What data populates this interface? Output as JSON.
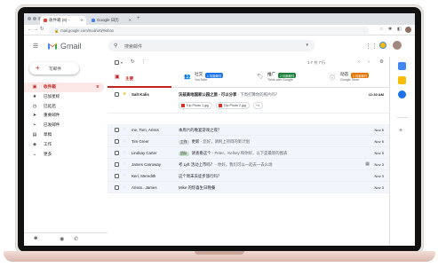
{
  "browser": {
    "tabs": [
      {
        "label": "收件箱 (8) - ",
        "active": true
      },
      {
        "label": "Google 日历",
        "active": false
      }
    ],
    "url": "mail.google.com/mail/u/0/#inbox"
  },
  "header": {
    "app_name": "Gmail",
    "search_placeholder": "搜索邮件"
  },
  "sidebar": {
    "compose_label": "写邮件",
    "items": [
      {
        "label": "收件箱",
        "icon": "inbox-icon",
        "count": "8",
        "active": true
      },
      {
        "label": "已加星标",
        "icon": "star-icon"
      },
      {
        "label": "已延后",
        "icon": "clock-icon"
      },
      {
        "label": "重要邮件",
        "icon": "important-icon"
      },
      {
        "label": "已发邮件",
        "icon": "send-icon"
      },
      {
        "label": "草稿",
        "icon": "draft-icon"
      },
      {
        "label": "工作",
        "icon": "label-icon"
      },
      {
        "label": "更多",
        "icon": "expand-icon"
      }
    ]
  },
  "toolbar": {
    "pagination": "1-7 共 7 行"
  },
  "categories": [
    {
      "name": "主要",
      "icon": "inbox-icon",
      "active": true
    },
    {
      "name": "社交",
      "icon": "people-icon",
      "badge": "1 封新邮件",
      "badge_color": "#1a73e8",
      "sub": "YouTube"
    },
    {
      "name": "推广",
      "icon": "tag-icon",
      "badge": "2 封新邮件",
      "badge_color": "#188038",
      "sub": "Think with Google"
    },
    {
      "name": "动态",
      "icon": "info-icon",
      "badge": "3 封新邮件",
      "badge_color": "#e37400",
      "sub": "Google Store"
    }
  ],
  "emails": [
    {
      "sender": "Salt Kalis",
      "subject": "沃兹美地国家公园之旅 - 可以分享",
      "snippet": "下周打算你的照片吗？",
      "date": "11:30 AM",
      "unread": true,
      "attachments": [
        "Trip Photo 1.jpg",
        "Trip Photo 2.jpg",
        "+1"
      ]
    },
    {
      "sender": "me, Tom, Arisss",
      "subject": "本周六的晚宴游戏之夜？",
      "date": "Nov 5",
      "unread": false
    },
    {
      "sender": "Tim Greer",
      "label": "工作",
      "label_color": "#dadce0",
      "subject": "更新",
      "snippet": "您好，请附上项目的新计划",
      "date": "Nov 5",
      "unread": false
    },
    {
      "sender": "Lindsay Carter",
      "label": "团队",
      "label_color": "#c8e6c9",
      "subject": "请查看这个",
      "snippet": "Peter、Kelsey 和你好，以下是最新的图表",
      "date": "Nov 5",
      "unread": false
    },
    {
      "sender": "James Carroway",
      "subject": "考 Lyft 活动上市吗？",
      "snippet": "你好，我们可以一起去一去么场",
      "date": "Nov 3",
      "unread": false
    },
    {
      "sender": "Keri, Meredith",
      "subject": "这个周末去徒步旅行吗？",
      "date": "Nov 3",
      "unread": false
    },
    {
      "sender": "Arisss...James",
      "subject": "Mike 的惊喜生日晚餐",
      "date": "Nov 3",
      "unread": false
    }
  ]
}
